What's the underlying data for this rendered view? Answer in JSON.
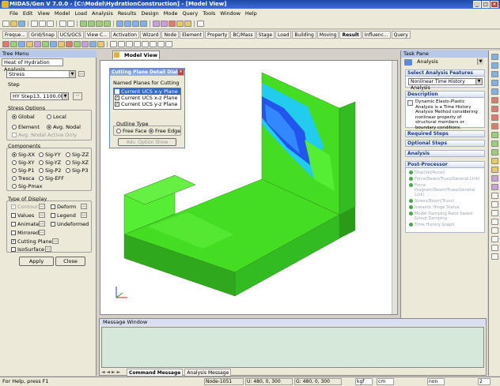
{
  "window": {
    "title": "MIDAS/Gen V 7.0.0 - [C:\\Model\\HydrationConstruction] - [Model View]"
  },
  "menu": [
    "File",
    "Edit",
    "View",
    "Model",
    "Load",
    "Analysis",
    "Results",
    "Design",
    "Mode",
    "Query",
    "Tools",
    "Window",
    "Help"
  ],
  "tabs": [
    "Freque...",
    "Grid/Snap",
    "UCS/GCS",
    "View C...",
    "Activation",
    "Wizard",
    "Node",
    "Element",
    "Property",
    "BC/Mass",
    "Stage",
    "Load",
    "Building",
    "Moving",
    "Result",
    "Influenc...",
    "Query"
  ],
  "active_tab": "Result",
  "tree": {
    "header": "Tree Menu",
    "tab": "Heat of Hydration Analysis",
    "result_type": "Stress",
    "step_label": "Step",
    "step_value": "HY Step13, 1100.0Hr",
    "stress_options_label": "Stress Options",
    "global": "Global",
    "local": "Local",
    "element": "Element",
    "avg_nodal": "Avg. Nodal",
    "avg_active": "Avg. Nodal Active Only",
    "components_label": "Components",
    "components": [
      "Sig-XX",
      "Sig-YY",
      "Sig-ZZ",
      "Sig-XY",
      "Sig-YZ",
      "Sig-XZ",
      "Sig-P1",
      "Sig-P2",
      "Sig-P3",
      "Tresca",
      "Sig-EFF",
      "Sig-Pmax"
    ],
    "display_label": "Type of Display",
    "contour": "Contour",
    "deform": "Deform",
    "values": "Values",
    "legend": "Legend",
    "animate": "Animate",
    "undeformed": "Undeformed",
    "mirrored": "Mirrored",
    "cutting_plane": "Cutting Plane",
    "isosurface": "IsoSurface",
    "apply": "Apply",
    "close": "Close"
  },
  "model_view": {
    "tab": "Model View"
  },
  "dialog": {
    "title": "Cutting Plane Detail Dialog",
    "list_label": "Named Planes for Cutting",
    "planes": [
      "Current UCS x-y Plane",
      "Current UCS x-z Plane",
      "Current UCS y-z Plane"
    ],
    "outline_label": "Outline Type",
    "free_face": "Free Face",
    "free_edge": "Free Edge",
    "adv_button": "Adv. Option Show"
  },
  "task": {
    "header": "Task Pane",
    "dropdown": "Analysis",
    "s1": "Select Analysis Features",
    "s1_value": "Nonlinear Time History Analysis",
    "s2": "Description",
    "desc": "Dynamic Elasto-Plastic Analysis is a Time History Analysis Method considering nonlinear property of structural members or boundary conditions.",
    "s3": "Required Steps",
    "s4": "Optional Steps",
    "s5": "Analysis",
    "s6": "Post-Processor",
    "post": [
      "Disp(Vel/Accel)",
      "Force(Beam/Truss/General Link)",
      "Force Diagram(Beam/Truss/General Link)",
      "Stress(Beam/Truss)",
      "Inelastic Hinge Status",
      "Model Damping Ratio based Group Damping",
      "Time History Graph"
    ]
  },
  "message": {
    "header": "Message Window",
    "tab1": "Command Message",
    "tab2": "Analysis Message"
  },
  "status": {
    "help": "For Help, press F1",
    "node": "Node-1051",
    "u": "U: 480, 0, 300",
    "g": "G: 480, 0, 300",
    "force_unit": "kgf",
    "length_unit": "cm",
    "page": "2"
  },
  "colors": {
    "contour_main": "#44dd22",
    "contour_blue": "#2255ee",
    "contour_cyan": "#22ccee",
    "select": "#316ac5"
  }
}
